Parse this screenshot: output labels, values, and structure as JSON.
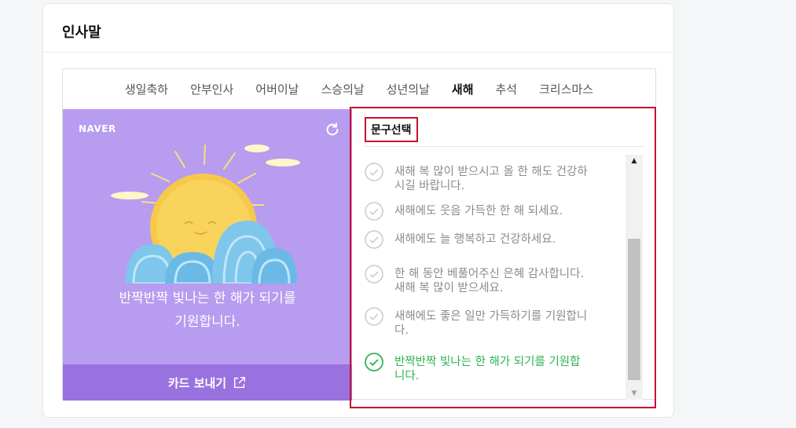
{
  "panel": {
    "title": "인사말"
  },
  "tabs": [
    {
      "label": "생일축하"
    },
    {
      "label": "안부인사"
    },
    {
      "label": "어버이날"
    },
    {
      "label": "스승의날"
    },
    {
      "label": "성년의날"
    },
    {
      "label": "새해",
      "active": true
    },
    {
      "label": "추석"
    },
    {
      "label": "크리스마스"
    }
  ],
  "card": {
    "logo": "NAVER",
    "message_line1": "반짝반짝 빛나는 한 해가 되기를",
    "message_line2": "기원합니다.",
    "send_label": "카드 보내기",
    "background_color": "#b79cf0"
  },
  "phrases": {
    "header": "문구선택",
    "items": [
      {
        "text_line1": "새해 복 많이 받으시고 올 한 해도 건강하",
        "text_line2": "시길 바랍니다.",
        "selected": false
      },
      {
        "text_line1": "새해에도 웃음 가득한 한 해 되세요.",
        "text_line2": "",
        "selected": false
      },
      {
        "text_line1": "새해에도 늘 행복하고 건강하세요.",
        "text_line2": "",
        "selected": false
      },
      {
        "text_line1": "한 해 동안 베풀어주신 은혜 감사합니다.",
        "text_line2": "새해 복 많이 받으세요.",
        "selected": false
      },
      {
        "text_line1": "새해에도 좋은 일만 가득하기를 기원합니",
        "text_line2": "다.",
        "selected": false
      },
      {
        "text_line1": "반짝반짝 빛나는 한 해가 되기를 기원합",
        "text_line2": "니다.",
        "selected": true
      }
    ]
  },
  "colors": {
    "accent_green": "#2db34f",
    "highlight_red": "#c8102e",
    "send_bar": "#9a72e0"
  }
}
